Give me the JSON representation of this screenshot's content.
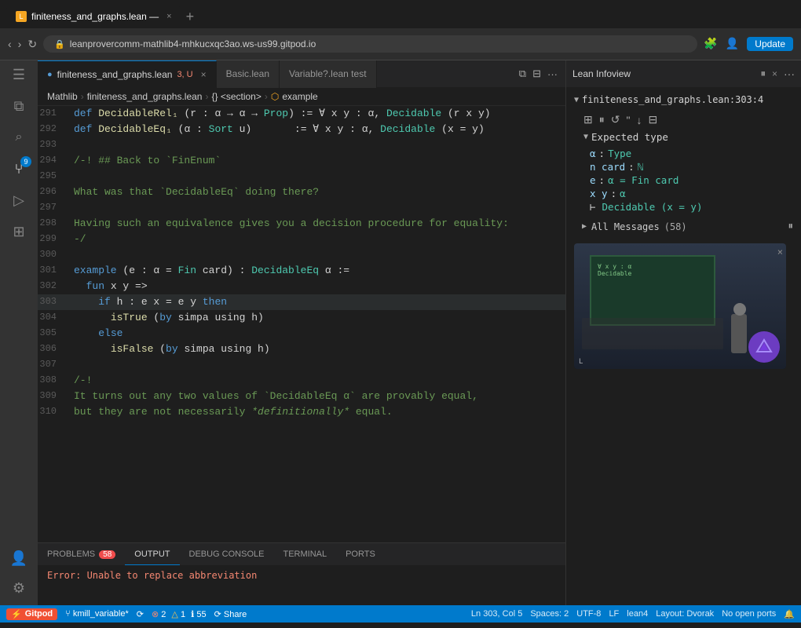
{
  "browser": {
    "tab_title": "finiteness_and_graphs.lean —",
    "tab_close": "×",
    "tab_new": "+",
    "url": "leanprovercomm-mathlib4-mhkucxqc3ao.ws-us99.gitpod.io",
    "update_btn": "Update"
  },
  "editor": {
    "tabs": [
      {
        "label": "finiteness_and_graphs.lean",
        "detail": "3, U",
        "active": true,
        "dirty": true
      },
      {
        "label": "Basic.lean",
        "active": false,
        "dirty": false
      },
      {
        "label": "Variable?.lean test",
        "active": false,
        "dirty": false
      }
    ],
    "breadcrumb": [
      "Mathlib",
      "finiteness_and_graphs.lean",
      "{}",
      "<section>",
      "example"
    ],
    "lines": [
      {
        "num": "291",
        "content": "def DecidableRel₁ (r : α → α → Prop) := ∀ x y : α, Decidable (r x y)"
      },
      {
        "num": "292",
        "content": "def DecidableEq₁ (α : Sort u)       := ∀ x y : α, Decidable (x = y)"
      },
      {
        "num": "293",
        "content": ""
      },
      {
        "num": "294",
        "content": "/-! ## Back to `FinEnum`"
      },
      {
        "num": "295",
        "content": ""
      },
      {
        "num": "296",
        "content": "What was that `DecidableEq` doing there?"
      },
      {
        "num": "297",
        "content": ""
      },
      {
        "num": "298",
        "content": "Having such an equivalence gives you a decision procedure for equality:"
      },
      {
        "num": "299",
        "content": "-/"
      },
      {
        "num": "300",
        "content": ""
      },
      {
        "num": "301",
        "content": "example (e : α = Fin card) : DecidableEq α :="
      },
      {
        "num": "302",
        "content": "  fun x y =>"
      },
      {
        "num": "303",
        "content": "    if h : e x = e y then",
        "active": true
      },
      {
        "num": "304",
        "content": "      isTrue (by simpa using h)"
      },
      {
        "num": "305",
        "content": "    else"
      },
      {
        "num": "306",
        "content": "      isFalse (by simpa using h)"
      },
      {
        "num": "307",
        "content": ""
      },
      {
        "num": "308",
        "content": "/-!"
      },
      {
        "num": "309",
        "content": "It turns out any two values of `DecidableEq α` are provably equal,"
      },
      {
        "num": "310",
        "content": "but they are not necessarily *definitionally* equal."
      }
    ]
  },
  "lean_infoview": {
    "title": "Lean Infoview",
    "close": "×",
    "file_ref": "finiteness_and_graphs.lean:303:4",
    "expected_type_label": "Expected type",
    "type_items": [
      {
        "var": "α",
        "sep": ":",
        "type": "Type"
      },
      {
        "var": "n card",
        "sep": ":",
        "type": "ℕ"
      },
      {
        "var": "e",
        "sep": ":",
        "type": "α = Fin card"
      },
      {
        "var": "x y",
        "sep": ":",
        "type": "α"
      },
      {
        "var": "⊢",
        "sep": "",
        "type": "Decidable (x = y)"
      }
    ],
    "all_messages_label": "All Messages",
    "all_messages_count": "(58)"
  },
  "panel": {
    "tabs": [
      {
        "label": "PROBLEMS",
        "badge": "58",
        "active": false
      },
      {
        "label": "OUTPUT",
        "active": true
      },
      {
        "label": "DEBUG CONSOLE",
        "active": false
      },
      {
        "label": "TERMINAL",
        "active": false
      },
      {
        "label": "PORTS",
        "active": false
      }
    ],
    "error_text": "Error: Unable to replace abbreviation"
  },
  "status_bar": {
    "gitpod": "Gitpod",
    "branch": "kmill_variable*",
    "sync_icon": "⟳",
    "errors": "2",
    "warnings": "1",
    "info": "55",
    "share": "Share",
    "cursor": "Ln 303, Col 5",
    "spaces": "Spaces: 2",
    "encoding": "UTF-8",
    "line_ending": "LF",
    "lang": "lean4",
    "layout": "Layout: Dvorak",
    "ports": "No open ports",
    "bell": "🔔"
  },
  "activity_icons": [
    {
      "name": "menu-icon",
      "icon": "☰",
      "active": false
    },
    {
      "name": "explorer-icon",
      "icon": "⧉",
      "active": false
    },
    {
      "name": "search-icon",
      "icon": "🔍",
      "active": false
    },
    {
      "name": "git-icon",
      "icon": "⑂",
      "active": true,
      "badge": "9"
    },
    {
      "name": "run-icon",
      "icon": "▶",
      "active": false
    },
    {
      "name": "extensions-icon",
      "icon": "⊞",
      "active": false
    }
  ]
}
